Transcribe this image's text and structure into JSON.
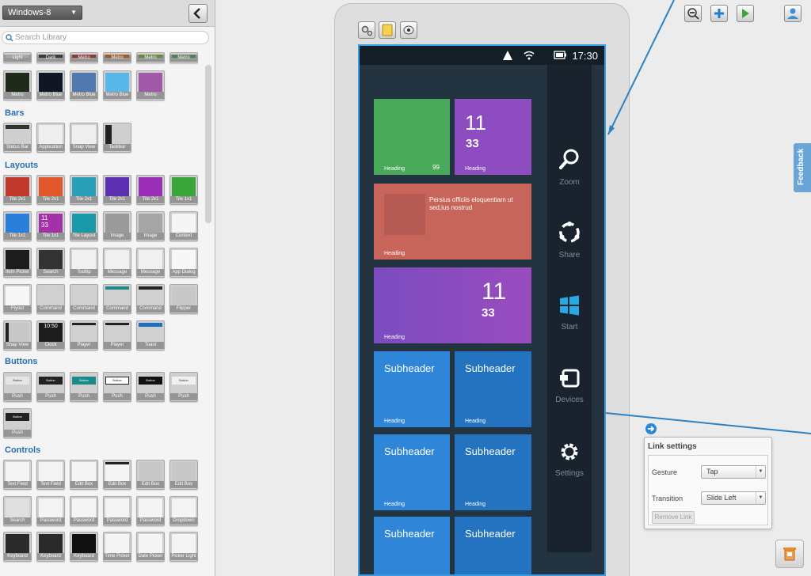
{
  "library": {
    "theme_select": "Windows-8",
    "search_placeholder": "Search Library",
    "sections": {
      "bars": "Bars",
      "layouts": "Layouts",
      "buttons": "Buttons",
      "controls": "Controls"
    },
    "thumbs": {
      "row0": [
        "Light",
        "Dark",
        "Metro",
        "Metro",
        "Metro",
        "Metro"
      ],
      "row1": [
        "Metro",
        "Metro Blue",
        "Metro Blue",
        "Metro Blue",
        "Metro"
      ],
      "bars": [
        "Status Bar",
        "Application",
        "Snap View",
        "Taskbar"
      ],
      "layout1": [
        "Tile 2x1",
        "Tile 2x1",
        "Tile 2x1",
        "Tile 2x1",
        "Tile 2x1",
        "Tile 1x1"
      ],
      "layout2": [
        "Tile 1x1",
        "Tile 1x1",
        "Tile Layout",
        "Image",
        "Image",
        "Context"
      ],
      "layout3": [
        "Item Picker",
        "Search",
        "Tooltip",
        "Message",
        "Message",
        "App Dialog"
      ],
      "layout4": [
        "Flyout",
        "Command",
        "Command",
        "Command",
        "Command",
        "Flipper"
      ],
      "layout5": [
        "Snap View",
        "Clock",
        "Player",
        "Player",
        "Toast"
      ],
      "buttons1": [
        "Push",
        "Push",
        "Push",
        "Push",
        "Push",
        "Push"
      ],
      "buttons2": [
        "Push"
      ],
      "controls1": [
        "Text Field",
        "Text Field",
        "Edit Box",
        "Edit Box",
        "Edit Box",
        "Edit Box"
      ],
      "controls2": [
        "Search",
        "Password",
        "Password",
        "Password",
        "Password",
        "Dropdown"
      ],
      "controls3": [
        "Keyboard",
        "Keyboard",
        "Keyboard",
        "Time Picker",
        "Date Picker",
        "Picker Light"
      ]
    },
    "thumb_text": {
      "clock": "10:50",
      "tile_num_top": "11",
      "tile_num_bottom": "33",
      "button": "Button"
    }
  },
  "device": {
    "status_time": "17:30",
    "charms": [
      {
        "label": "Zoom",
        "icon": "search-icon"
      },
      {
        "label": "Share",
        "icon": "share-icon"
      },
      {
        "label": "Start",
        "icon": "windows-icon"
      },
      {
        "label": "Devices",
        "icon": "devices-icon"
      },
      {
        "label": "Settings",
        "icon": "gear-icon"
      }
    ],
    "tiles": {
      "green_heading": "Heading",
      "green_count": "99",
      "purple_small_num_top": "11",
      "purple_small_num_bottom": "33",
      "purple_small_heading": "Heading",
      "wide_text": "Persius officiis eloquentiam ut sed,ius nostrud",
      "wide_heading": "Heading",
      "purple_wide_num_top": "11",
      "purple_wide_num_bottom": "33",
      "purple_wide_heading": "Heading",
      "subheader": "Subheader",
      "heading": "Heading"
    }
  },
  "link_settings": {
    "title": "Link settings",
    "gesture_label": "Gesture",
    "gesture_value": "Tap",
    "transition_label": "Transition",
    "transition_value": "Slide Left",
    "remove_label": "Remove Link"
  },
  "feedback_label": "Feedback",
  "colors": {
    "accent": "#3a9be0",
    "tile_green": "#4aa85a",
    "tile_purple": "#8d4cbf",
    "tile_salmon": "#c8655a",
    "tile_blue": "#2f86d8",
    "tile_blue_dark": "#2373c0",
    "windows_blue": "#28a9e5"
  }
}
